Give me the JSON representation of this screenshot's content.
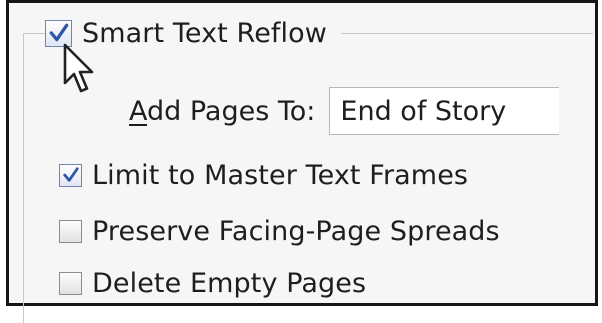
{
  "smart_reflow": {
    "label": "Smart Text Reflow",
    "checked": true
  },
  "add_pages": {
    "label_accel": "A",
    "label_rest": "dd Pages To:",
    "selected_value": "End of Story"
  },
  "options": [
    {
      "label": "Limit to Master Text Frames",
      "checked": true
    },
    {
      "label": "Preserve Facing-Page Spreads",
      "checked": false
    },
    {
      "label": "Delete Empty Pages",
      "checked": false
    }
  ],
  "colors": {
    "check_mark": "#2e56a6",
    "panel_bg": "#f6f6f6",
    "border": "#151515"
  }
}
